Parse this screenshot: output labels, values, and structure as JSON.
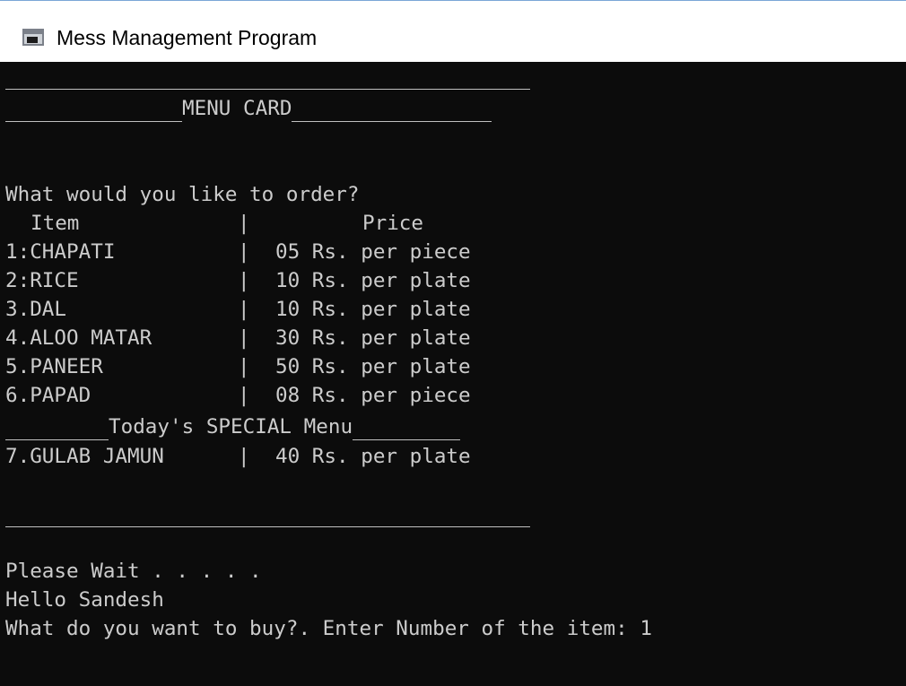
{
  "window": {
    "title": "Mess Management Program",
    "icon": "console-window-icon"
  },
  "console": {
    "menu_card_heading": "MENU CARD",
    "prompt": "What would you like to order?",
    "table_header": {
      "item": "Item",
      "price": "Price"
    },
    "menu_items": [
      {
        "item": "1:CHAPATI",
        "price": "05 Rs. per piece"
      },
      {
        "item": "2:RICE",
        "price": "10 Rs. per plate"
      },
      {
        "item": "3.DAL",
        "price": "10 Rs. per plate"
      },
      {
        "item": "4.ALOO MATAR",
        "price": "30 Rs. per plate"
      },
      {
        "item": "5.PANEER",
        "price": "50 Rs. per plate"
      },
      {
        "item": "6.PAPAD",
        "price": "08 Rs. per piece"
      }
    ],
    "special_heading": "Today's SPECIAL Menu",
    "special_items": [
      {
        "item": "7.GULAB JAMUN",
        "price": "40 Rs. per plate"
      }
    ],
    "wait_message": "Please Wait . . . . .",
    "greeting": "Hello Sandesh",
    "buy_prompt": "What do you want to buy?. Enter Number of the item: 1"
  }
}
